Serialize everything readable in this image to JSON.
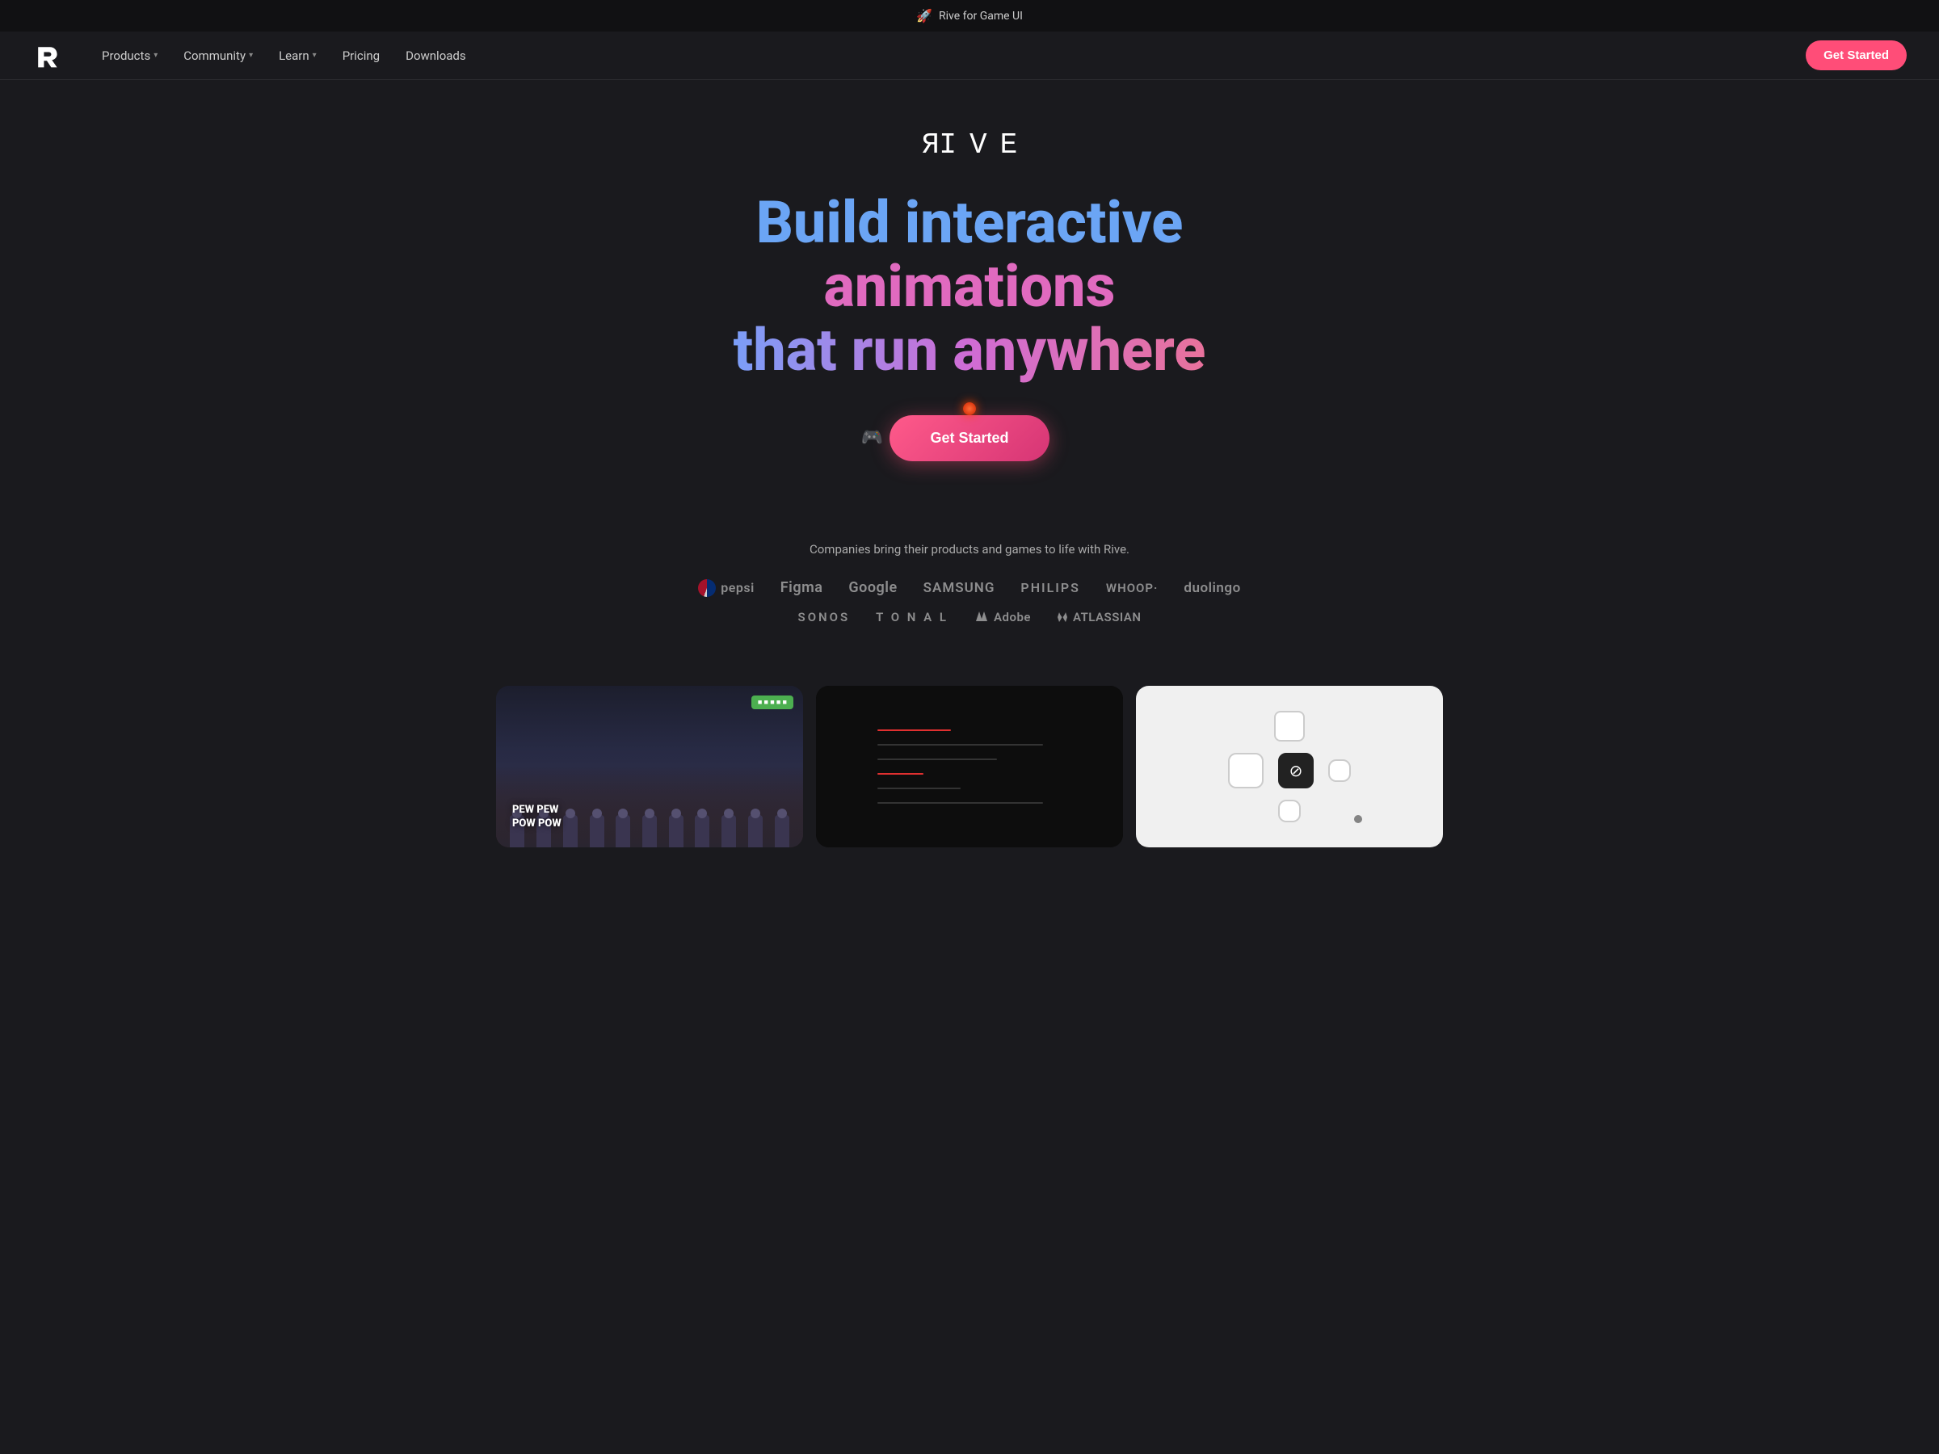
{
  "banner": {
    "icon": "🚀",
    "text": "Rive for Game UI"
  },
  "nav": {
    "logo_alt": "Rive Logo",
    "links": [
      {
        "label": "Products",
        "has_dropdown": true
      },
      {
        "label": "Community",
        "has_dropdown": true
      },
      {
        "label": "Learn",
        "has_dropdown": true
      },
      {
        "label": "Pricing",
        "has_dropdown": false
      },
      {
        "label": "Downloads",
        "has_dropdown": false
      }
    ],
    "cta": "Get Started"
  },
  "hero": {
    "logo_text": "RIVE",
    "headline_line1": "Build interactive",
    "headline_line2": "animations",
    "headline_line3": "that run anywhere",
    "cta_button": "Get Started"
  },
  "companies": {
    "tagline": "Companies bring their products and games to life with Rive.",
    "logos": [
      "pepsi",
      "Figma",
      "Google",
      "SAMSUNG",
      "PHILIPS",
      "WHOOP·",
      "duolingo",
      "SONOS",
      "T O N A L",
      "Adobe",
      "ATLASSIAN"
    ]
  },
  "previews": [
    {
      "type": "game",
      "label": "PEW PEW\nPOW POW"
    },
    {
      "type": "editor"
    },
    {
      "type": "ui"
    }
  ]
}
